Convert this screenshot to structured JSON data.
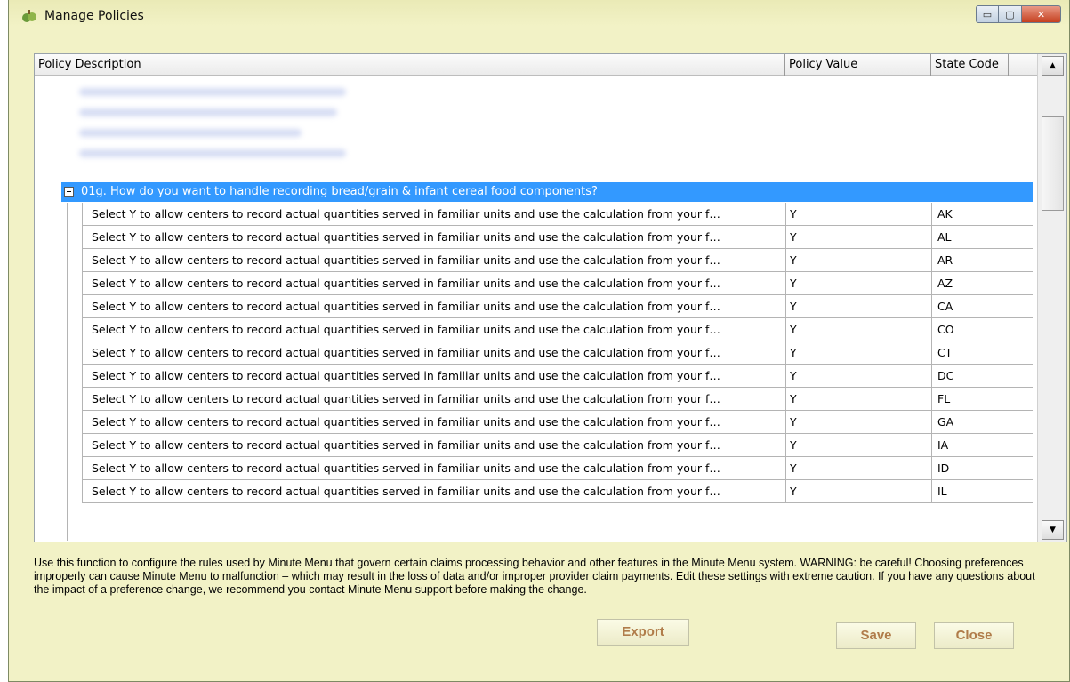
{
  "window": {
    "title": "Manage Policies",
    "controls": {
      "minimize": "▭",
      "maximize": "▢",
      "close": "✕"
    }
  },
  "grid": {
    "columns": [
      "Policy Description",
      "Policy Value",
      "State Code"
    ],
    "group_row": "01g. How do you want to handle recording bread/grain & infant cereal food components?",
    "rows": [
      {
        "description": "Select Y to allow centers to record actual quantities served in familiar units and use the calculation from your f…",
        "value": "Y",
        "state": "AK"
      },
      {
        "description": "Select Y to allow centers to record actual quantities served in familiar units and use the calculation from your f…",
        "value": "Y",
        "state": "AL"
      },
      {
        "description": "Select Y to allow centers to record actual quantities served in familiar units and use the calculation from your f…",
        "value": "Y",
        "state": "AR"
      },
      {
        "description": "Select Y to allow centers to record actual quantities served in familiar units and use the calculation from your f…",
        "value": "Y",
        "state": "AZ"
      },
      {
        "description": "Select Y to allow centers to record actual quantities served in familiar units and use the calculation from your f…",
        "value": "Y",
        "state": "CA"
      },
      {
        "description": "Select Y to allow centers to record actual quantities served in familiar units and use the calculation from your f…",
        "value": "Y",
        "state": "CO"
      },
      {
        "description": "Select Y to allow centers to record actual quantities served in familiar units and use the calculation from your f…",
        "value": "Y",
        "state": "CT"
      },
      {
        "description": "Select Y to allow centers to record actual quantities served in familiar units and use the calculation from your f…",
        "value": "Y",
        "state": "DC"
      },
      {
        "description": "Select Y to allow centers to record actual quantities served in familiar units and use the calculation from your f…",
        "value": "Y",
        "state": "FL"
      },
      {
        "description": "Select Y to allow centers to record actual quantities served in familiar units and use the calculation from your f…",
        "value": "Y",
        "state": "GA"
      },
      {
        "description": "Select Y to allow centers to record actual quantities served in familiar units and use the calculation from your f…",
        "value": "Y",
        "state": "IA"
      },
      {
        "description": "Select Y to allow centers to record actual quantities served in familiar units and use the calculation from your f…",
        "value": "Y",
        "state": "ID"
      },
      {
        "description": "Select Y to allow centers to record actual quantities served in familiar units and use the calculation from your f…",
        "value": "Y",
        "state": "IL"
      }
    ]
  },
  "info_text": "Use this function to configure the rules used by Minute Menu that govern certain claims processing behavior and other features in the Minute Menu system. WARNING:  be careful!  Choosing preferences improperly can cause Minute Menu to malfunction – which may result in the loss of data and/or improper provider claim payments.  Edit these settings with extreme caution.  If you have any questions about the impact of a preference change, we recommend you contact Minute Menu support before making the change.",
  "buttons": {
    "export": "Export",
    "save": "Save",
    "close": "Close"
  },
  "colors": {
    "selection": "#3399ff",
    "window_bg": "#f2f2c6",
    "button_text": "#b07c4a"
  }
}
